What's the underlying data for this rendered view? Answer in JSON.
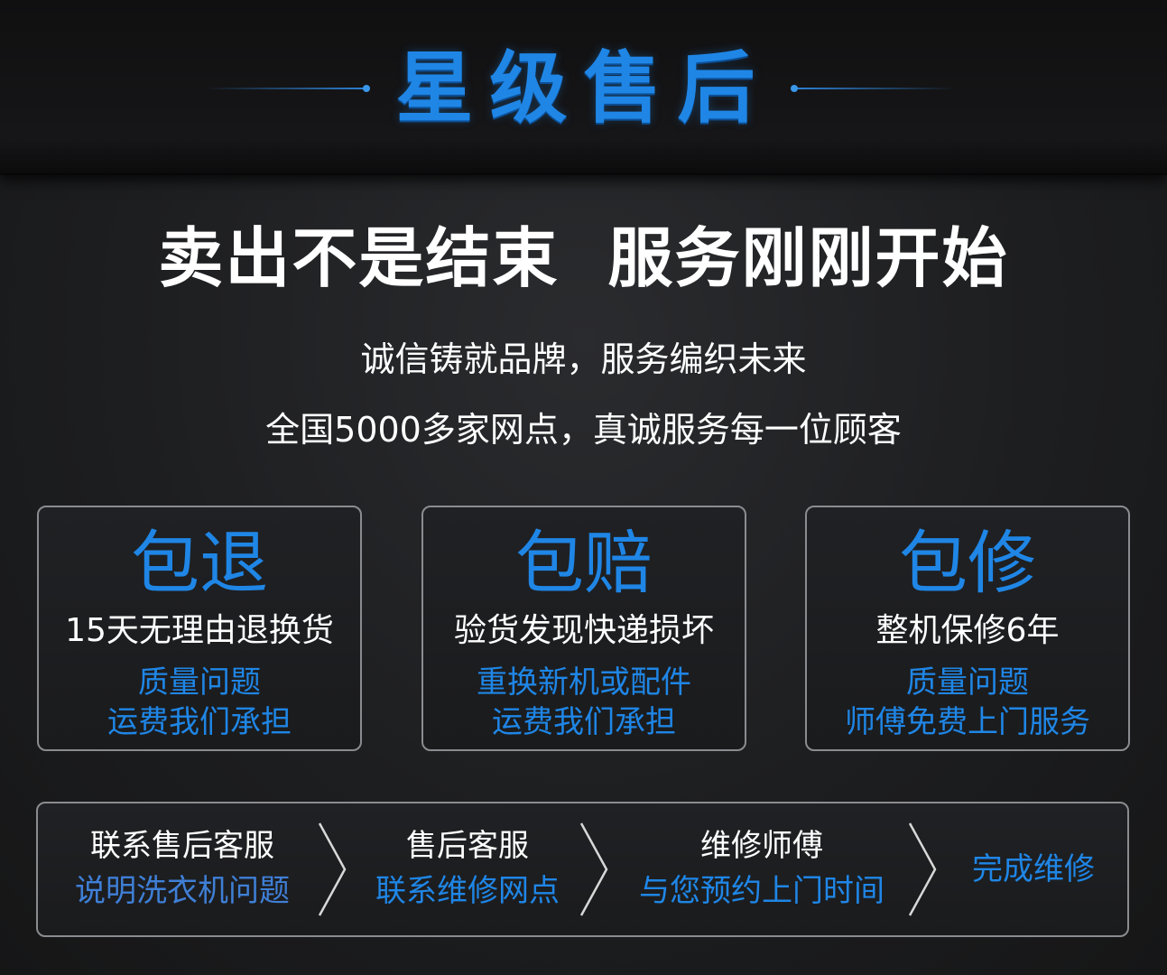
{
  "header": {
    "title": "星级售后"
  },
  "slogan": "卖出不是结束  服务刚刚开始",
  "subtitles": [
    "诚信铸就品牌，服务编织未来",
    "全国5000多家网点，真诚服务每一位顾客"
  ],
  "cards": [
    {
      "title": "包退",
      "line": "15天无理由退换货",
      "blue": [
        "质量问题",
        "运费我们承担"
      ]
    },
    {
      "title": "包赔",
      "line": "验货发现快递损坏",
      "blue": [
        "重换新机或配件",
        "运费我们承担"
      ]
    },
    {
      "title": "包修",
      "line": "整机保修6年",
      "blue": [
        "质量问题",
        "师傅免费上门服务"
      ]
    }
  ],
  "process": [
    {
      "top": "联系售后客服",
      "bottom": "说明洗衣机问题"
    },
    {
      "top": "售后客服",
      "bottom": "联系维修网点"
    },
    {
      "top": "维修师傅",
      "bottom": "与您预约上门时间"
    },
    {
      "single": "完成维修"
    }
  ],
  "colors": {
    "accent_blue": "#1f86e6",
    "text_white": "#ffffff",
    "border_gray": "#8a8c90",
    "background": "#1d1e20"
  },
  "icons": {
    "step_arrow": "chevron-right-icon"
  }
}
